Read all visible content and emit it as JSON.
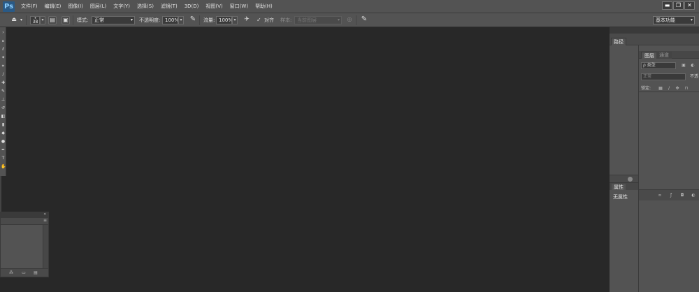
{
  "app": {
    "logo": "Ps"
  },
  "menu": [
    "文件(F)",
    "编辑(E)",
    "图像(I)",
    "图层(L)",
    "文字(Y)",
    "选择(S)",
    "滤镜(T)",
    "3D(D)",
    "视图(V)",
    "窗口(W)",
    "帮助(H)"
  ],
  "window_controls": {
    "minimize": "▬",
    "restore": "❐",
    "close": "✕"
  },
  "options": {
    "brush_size": "38",
    "mode_label": "模式:",
    "mode_value": "正常",
    "opacity_label": "不透明度:",
    "opacity_value": "100%",
    "flow_label": "流量:",
    "flow_value": "100%",
    "aligned_label": "对齐",
    "aligned_checked": "✓",
    "sample_label": "样本:",
    "sample_value": "当前图层",
    "workspace_value": "基本功能"
  },
  "paths_panel": {
    "tab": "路径"
  },
  "layers_panel": {
    "tabs": [
      "图层",
      "通道"
    ],
    "filter_value": "ρ 类型",
    "blend_value": "正常",
    "opacity_label": "不透",
    "lock_label": "锁定:"
  },
  "properties_panel": {
    "tab": "属性",
    "empty_text": "无属性"
  },
  "icons": {
    "tool_preset": "stamp-icon",
    "aligned": "check-icon",
    "workspace": "dropdown-icon"
  }
}
